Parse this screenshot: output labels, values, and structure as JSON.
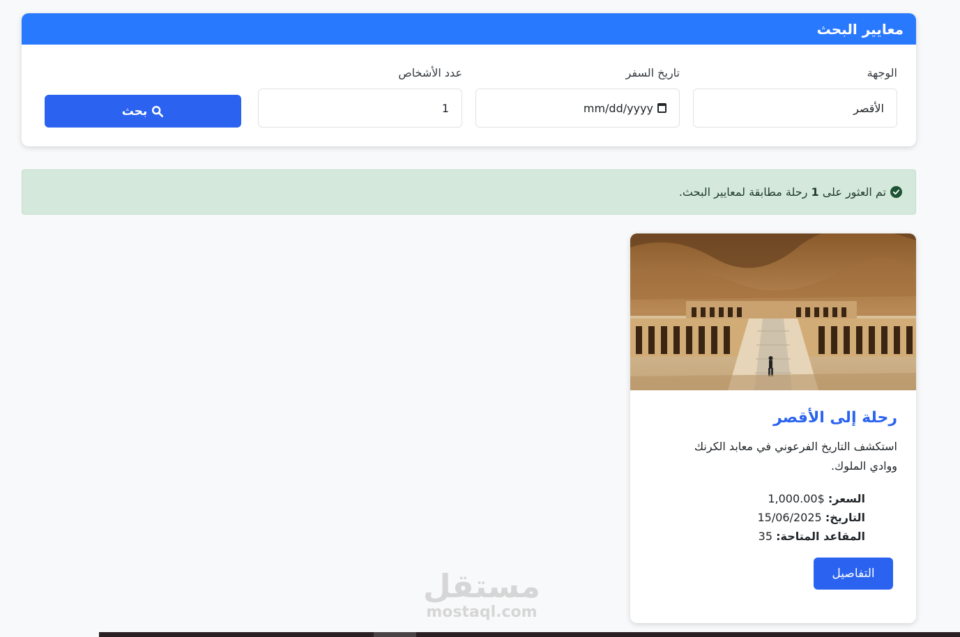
{
  "search": {
    "title": "معايير البحث",
    "destination_label": "الوجهة",
    "destination_value": "الأقصر",
    "date_label": "تاريخ السفر",
    "date_placeholder": "mm/dd/yyyy",
    "persons_label": "عدد الأشخاص",
    "persons_value": "1",
    "button_label": "بحث"
  },
  "alert": {
    "prefix": "تم العثور على",
    "count": "1",
    "suffix": "رحلة مطابقة لمعايير البحث."
  },
  "trip": {
    "title": "رحلة إلى الأقصر",
    "description": "استكشف التاريخ الفرعوني في معابد الكرنك ووادي الملوك.",
    "price_label": "السعر:",
    "price_value": "$1,000.00",
    "date_label": "التاريخ:",
    "date_value": "15/06/2025",
    "seats_label": "المقاعد المتاحة:",
    "seats_value": "35",
    "details_label": "التفاصيل"
  },
  "watermark": {
    "ar": "مستقل",
    "en": "mostaql.com"
  },
  "colors": {
    "primary": "#2b63f0",
    "header": "#2979ff",
    "alert_bg": "#d4e8dc",
    "check": "#1e5234"
  },
  "icons": [
    "search-icon",
    "calendar-icon",
    "check-circle-icon"
  ]
}
